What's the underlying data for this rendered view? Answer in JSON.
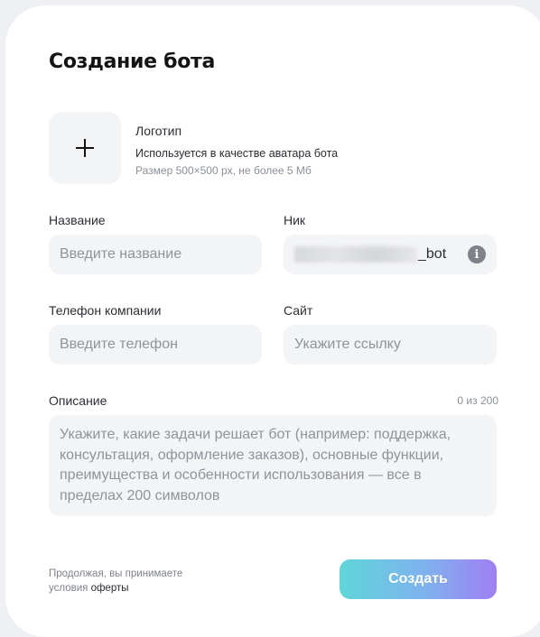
{
  "form": {
    "title": "Создание бота",
    "logo": {
      "label": "Логотип",
      "description": "Используется в качестве аватара бота",
      "hint": "Размер 500×500 px, не более 5 Мб"
    },
    "name": {
      "label": "Название",
      "placeholder": "Введите название"
    },
    "nick": {
      "label": "Ник",
      "suffix": "_bot"
    },
    "phone": {
      "label": "Телефон компании",
      "placeholder": "Введите телефон"
    },
    "site": {
      "label": "Сайт",
      "placeholder": "Укажите ссылку"
    },
    "description": {
      "label": "Описание",
      "counter": "0 из 200",
      "placeholder": "Укажите, какие задачи решает бот (например: поддержка, консультация, оформление заказов), основные функции, преимущества и особенности использования — все в пределах 200 символов"
    },
    "terms": {
      "text": "Продолжая, вы принимаете",
      "prefix": "условия ",
      "link": "оферты"
    },
    "submit_label": "Создать"
  },
  "icons": {
    "plus": "plus-icon",
    "info": "info-icon"
  }
}
